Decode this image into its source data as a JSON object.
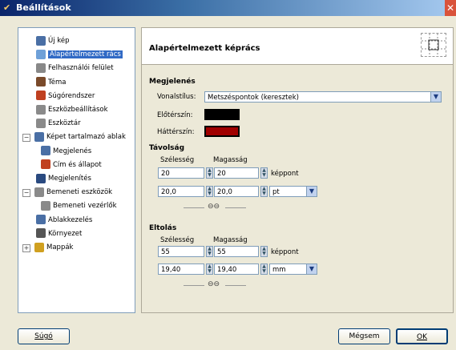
{
  "window": {
    "title": "Beállítások",
    "close_glyph": "✕"
  },
  "tree": {
    "items": [
      {
        "label": "Új kép",
        "icon": "new-image-icon",
        "color": "#4a6fa5"
      },
      {
        "label": "Alapértelmezett rács",
        "icon": "grid-icon",
        "color": "#6ea0d8",
        "selected": true
      },
      {
        "label": "Felhasználói felület",
        "icon": "interface-icon",
        "color": "#888888"
      },
      {
        "label": "Téma",
        "icon": "theme-icon",
        "color": "#7a4a2a"
      },
      {
        "label": "Súgórendszer",
        "icon": "help-system-icon",
        "color": "#c04020"
      },
      {
        "label": "Eszközbeállítások",
        "icon": "tool-options-icon",
        "color": "#8a8a8a"
      },
      {
        "label": "Eszköztár",
        "icon": "toolbox-icon",
        "color": "#8a8a8a"
      },
      {
        "label": "Képet tartalmazó ablak",
        "icon": "image-window-icon",
        "color": "#4a6fa5",
        "expander": "−"
      },
      {
        "label": "Megjelenés",
        "icon": "appearance-icon",
        "color": "#4a6fa5"
      },
      {
        "label": "Cím és állapot",
        "icon": "title-status-icon",
        "color": "#c04020"
      },
      {
        "label": "Megjelenítés",
        "icon": "display-icon",
        "color": "#2a4a80"
      },
      {
        "label": "Bemeneti eszközök",
        "icon": "input-devices-icon",
        "color": "#8a8a8a",
        "expander": "−"
      },
      {
        "label": "Bemeneti vezérlők",
        "icon": "input-controllers-icon",
        "color": "#8a8a8a"
      },
      {
        "label": "Ablakkezelés",
        "icon": "window-management-icon",
        "color": "#4a6fa5"
      },
      {
        "label": "Környezet",
        "icon": "environment-icon",
        "color": "#555555"
      },
      {
        "label": "Mappák",
        "icon": "folders-icon",
        "color": "#d0a020",
        "expander": "+"
      }
    ]
  },
  "panel": {
    "title": "Alapértelmezett képrács",
    "appearance": {
      "heading": "Megjelenés",
      "line_style_label": "Vonalstílus:",
      "line_style_value": "Metszéspontok (keresztek)",
      "fg_label": "Előtérszín:",
      "fg_color": "#000000",
      "bg_label": "Háttérszín:",
      "bg_color": "#a00000"
    },
    "spacing": {
      "heading": "Távolság",
      "width_label": "Szélesség",
      "height_label": "Magasság",
      "width_px": "20",
      "height_px": "20",
      "px_unit": "képpont",
      "width_unit_val": "20,0",
      "height_unit_val": "20,0",
      "unit": "pt",
      "chain_glyph": "⊖⊖"
    },
    "offset": {
      "heading": "Eltolás",
      "width_label": "Szélesség",
      "height_label": "Magasság",
      "width_px": "55",
      "height_px": "55",
      "px_unit": "képpont",
      "width_unit_val": "19,40",
      "height_unit_val": "19,40",
      "unit": "mm",
      "chain_glyph": "⊖⊖"
    }
  },
  "buttons": {
    "help": "Súgó",
    "cancel": "Mégsem",
    "ok": "OK"
  }
}
